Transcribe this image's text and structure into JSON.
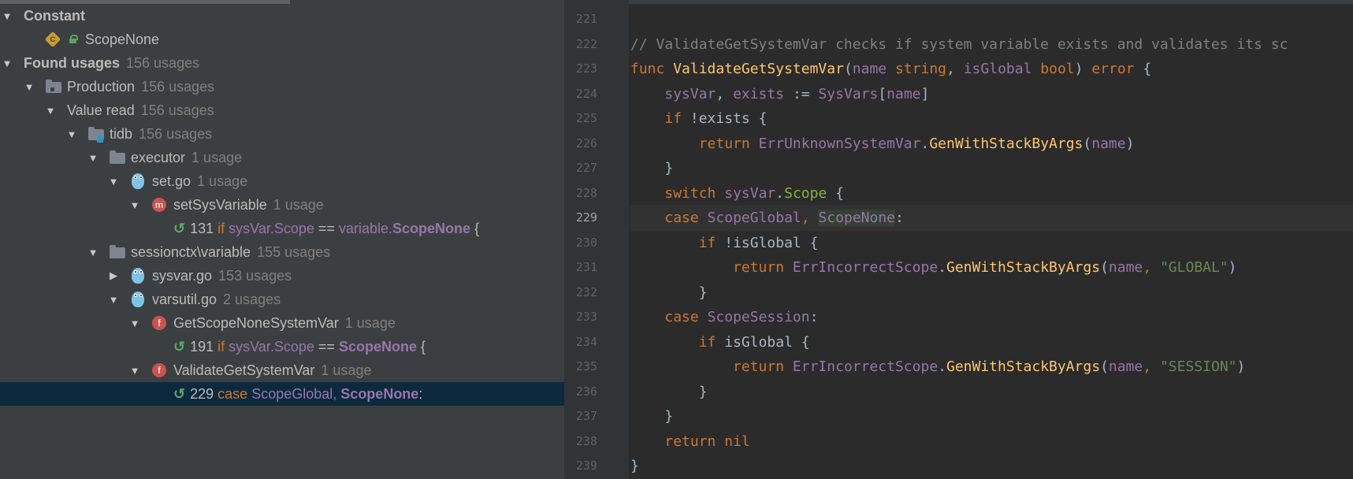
{
  "usages_panel": {
    "rows": [
      {
        "label": "Constant",
        "count": ""
      },
      {
        "label": "ScopeNone",
        "count": ""
      },
      {
        "label": "Found usages",
        "count": "156 usages"
      },
      {
        "label": "Production",
        "count": "156 usages"
      },
      {
        "label": "Value read",
        "count": "156 usages"
      },
      {
        "label": "tidb",
        "count": "156 usages"
      },
      {
        "label": "executor",
        "count": "1 usage"
      },
      {
        "label": "set.go",
        "count": "1 usage"
      },
      {
        "label": "setSysVariable",
        "count": "1 usage"
      },
      {
        "line": "131",
        "t1": "if",
        "t2": "sysVar.Scope",
        "t3": "==",
        "t4": "variable.",
        "t5": "ScopeNone",
        "t6": "{"
      },
      {
        "label": "sessionctx\\variable",
        "count": "155 usages"
      },
      {
        "label": "sysvar.go",
        "count": "153 usages"
      },
      {
        "label": "varsutil.go",
        "count": "2 usages"
      },
      {
        "label": "GetScopeNoneSystemVar",
        "count": "1 usage"
      },
      {
        "line": "191",
        "t1": "if",
        "t2": "sysVar.Scope",
        "t3": "==",
        "t5": "ScopeNone",
        "t6": "{"
      },
      {
        "label": "ValidateGetSystemVar",
        "count": "1 usage"
      },
      {
        "line": "229",
        "t1": "case",
        "t2": "ScopeGlobal,",
        "t5": "ScopeNone",
        "t6": ":"
      }
    ],
    "icons": {
      "constant_icon": "C",
      "method_icon": "m",
      "function_icon": "f"
    }
  },
  "editor": {
    "line_numbers": [
      "221",
      "222",
      "223",
      "224",
      "225",
      "226",
      "227",
      "228",
      "229",
      "230",
      "231",
      "232",
      "233",
      "234",
      "235",
      "236",
      "237",
      "238",
      "239"
    ],
    "current_line": "229",
    "code": {
      "l222": "// ValidateGetSystemVar checks if system variable exists and validates its sc",
      "l223": {
        "kw": "func",
        "fn": "ValidateGetSystemVar",
        "p1": "(",
        "a1": "name",
        "t1": "string",
        "c1": ", ",
        "a2": "isGlobal",
        "t2": "bool",
        "p2": ")",
        "ret": "error",
        "br": "{"
      },
      "l224": {
        "v1": "sysVar",
        "c": ", ",
        "v2": "exists",
        "op": " := ",
        "g": "SysVars",
        "b1": "[",
        "a": "name",
        "b2": "]"
      },
      "l225": {
        "kw": "if",
        "rest": " !exists {"
      },
      "l226": {
        "kw": "return",
        "g": "ErrUnknownSystemVar",
        "dot": ".",
        "call": "GenWithStackByArgs",
        "p1": "(",
        "a": "name",
        "p2": ")"
      },
      "l227": "}",
      "l228": {
        "kw": "switch",
        "v": "sysVar",
        "dot": ".",
        "f": "Scope",
        "br": " {"
      },
      "l229": {
        "kw": "case",
        "g1": "ScopeGlobal",
        "c": ", ",
        "g2": "ScopeNone",
        "colon": ":"
      },
      "l230": {
        "kw": "if",
        "rest": " !isGlobal {"
      },
      "l231": {
        "kw": "return",
        "g": "ErrIncorrectScope",
        "dot": ".",
        "call": "GenWithStackByArgs",
        "p1": "(",
        "a": "name",
        "c": ", ",
        "s": "\"GLOBAL\"",
        "p2": ")"
      },
      "l232": "}",
      "l233": {
        "kw": "case",
        "g": "ScopeSession",
        "colon": ":"
      },
      "l234": {
        "kw": "if",
        "rest": " isGlobal {"
      },
      "l235": {
        "kw": "return",
        "g": "ErrIncorrectScope",
        "dot": ".",
        "call": "GenWithStackByArgs",
        "p1": "(",
        "a": "name",
        "c": ", ",
        "s": "\"SESSION\"",
        "p2": ")"
      },
      "l236": "}",
      "l237": "}",
      "l238": {
        "kw": "return",
        "rest": " nil"
      },
      "l239": "}"
    }
  },
  "colors": {
    "panel_bg": "#3c3f41",
    "editor_bg": "#2b2b2b",
    "selection": "#0d293e",
    "keyword": "#cc7832",
    "identifier_purple": "#9876aa",
    "function_yellow": "#ffc66d",
    "string_green": "#6a8759",
    "comment_gray": "#808080"
  }
}
